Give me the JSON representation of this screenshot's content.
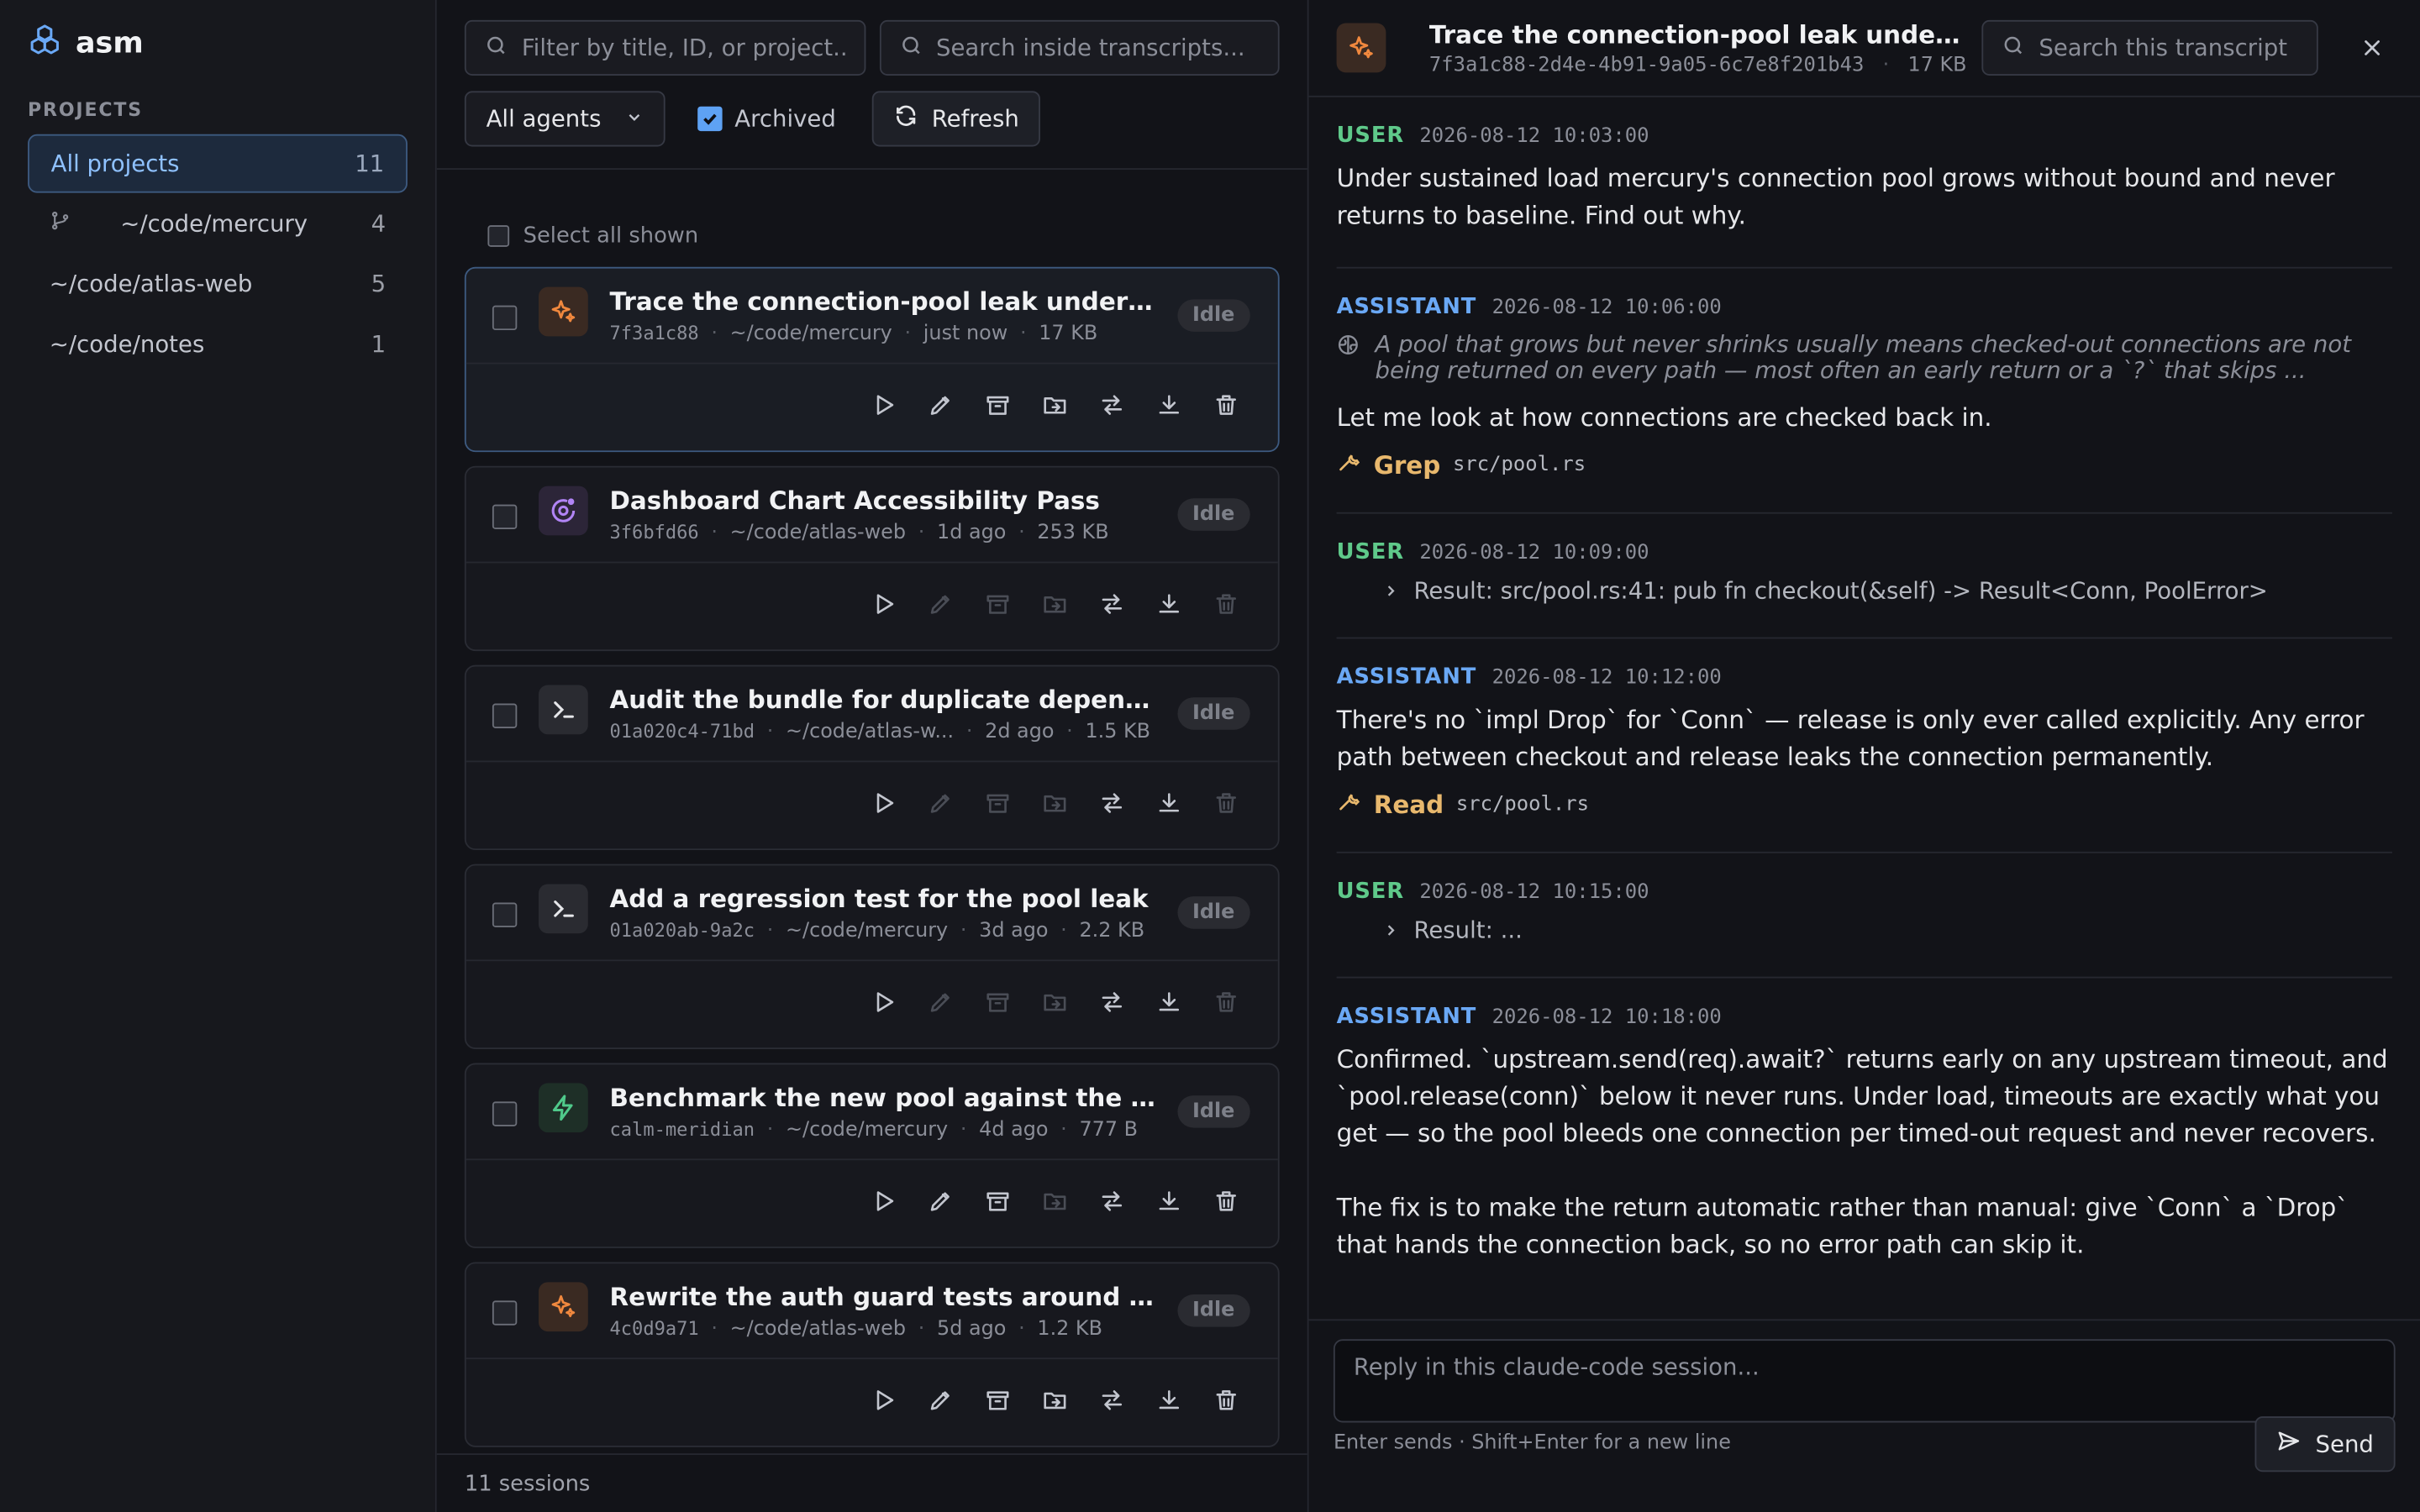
{
  "app": {
    "name": "asm"
  },
  "sidebar": {
    "section_label": "PROJECTS",
    "projects": [
      {
        "label": "All projects",
        "count": "11"
      },
      {
        "label": "~/code/mercury",
        "count": "4"
      },
      {
        "label": "~/code/atlas-web",
        "count": "5"
      },
      {
        "label": "~/code/notes",
        "count": "1"
      }
    ]
  },
  "toolbar": {
    "filter_placeholder": "Filter by title, ID, or project...",
    "search_placeholder": "Search inside transcripts...",
    "agents_label": "All agents",
    "archived_label": "Archived",
    "refresh_label": "Refresh"
  },
  "list": {
    "select_all": "Select all shown",
    "sessions": [
      {
        "title": "Trace the connection-pool leak under sustained load",
        "id": "7f3a1c88",
        "project": "~/code/mercury",
        "time": "just now",
        "size": "17 KB",
        "status": "Idle",
        "agent": "sparkle"
      },
      {
        "title": "Dashboard Chart Accessibility Pass",
        "id": "3f6bfd66",
        "project": "~/code/atlas-web",
        "time": "1d ago",
        "size": "253 KB",
        "status": "Idle",
        "agent": "orbit"
      },
      {
        "title": "Audit the bundle for duplicate dependencies",
        "id": "01a020c4-71bd",
        "project": "~/code/atlas-w...",
        "time": "2d ago",
        "size": "1.5 KB",
        "status": "Idle",
        "agent": "terminal"
      },
      {
        "title": "Add a regression test for the pool leak",
        "id": "01a020ab-9a2c",
        "project": "~/code/mercury",
        "time": "3d ago",
        "size": "2.2 KB",
        "status": "Idle",
        "agent": "terminal"
      },
      {
        "title": "Benchmark the new pool against the old one",
        "id": "calm-meridian",
        "project": "~/code/mercury",
        "time": "4d ago",
        "size": "777 B",
        "status": "Idle",
        "agent": "bolt"
      },
      {
        "title": "Rewrite the auth guard tests around the new API",
        "id": "4c0d9a71",
        "project": "~/code/atlas-web",
        "time": "5d ago",
        "size": "1.2 KB",
        "status": "Idle",
        "agent": "sparkle"
      }
    ],
    "footer": "11 sessions"
  },
  "transcript": {
    "title": "Trace the connection-pool leak under sustained load",
    "session_id": "7f3a1c88-2d4e-4b91-9a05-6c7e8f201b43",
    "size": "17 KB",
    "search_placeholder": "Search this transcript",
    "messages": [
      {
        "role": "USER",
        "time": "2026-08-12 10:03:00",
        "text": "Under sustained load mercury's connection pool grows without bound and never returns to baseline. Find out why."
      },
      {
        "role": "ASSISTANT",
        "time": "2026-08-12 10:06:00",
        "thinking": "A pool that grows but never shrinks usually means checked-out connections are not being returned on every path — most often an early return or a `?` that skips ...",
        "text": "Let me look at how connections are checked back in.",
        "tool": "Grep",
        "tool_arg": "src/pool.rs"
      },
      {
        "role": "USER",
        "time": "2026-08-12 10:09:00",
        "result": "Result: src/pool.rs:41: pub fn checkout(&self) -> Result<Conn, PoolError>"
      },
      {
        "role": "ASSISTANT",
        "time": "2026-08-12 10:12:00",
        "text": "There's no `impl Drop` for `Conn` — release is only ever called explicitly. Any error path between checkout and release leaks the connection permanently.",
        "tool": "Read",
        "tool_arg": "src/pool.rs"
      },
      {
        "role": "USER",
        "time": "2026-08-12 10:15:00",
        "result": "Result: ..."
      },
      {
        "role": "ASSISTANT",
        "time": "2026-08-12 10:18:00",
        "text": "Confirmed. `upstream.send(req).await?` returns early on any upstream timeout, and `pool.release(conn)` below it never runs. Under load, timeouts are exactly what you get — so the pool bleeds one connection per timed-out request and never recovers.",
        "text2": "The fix is to make the return automatic rather than manual: give `Conn` a `Drop` that hands the connection back, so no error path can skip it."
      }
    ],
    "reply_placeholder": "Reply in this claude-code session...",
    "hint": "Enter sends · Shift+Enter for a new line",
    "send_label": "Send"
  },
  "colors": {
    "accent": "#5ea2f4",
    "user": "#5fc98a",
    "assistant": "#6aa8f5",
    "tool": "#e8b86d"
  }
}
